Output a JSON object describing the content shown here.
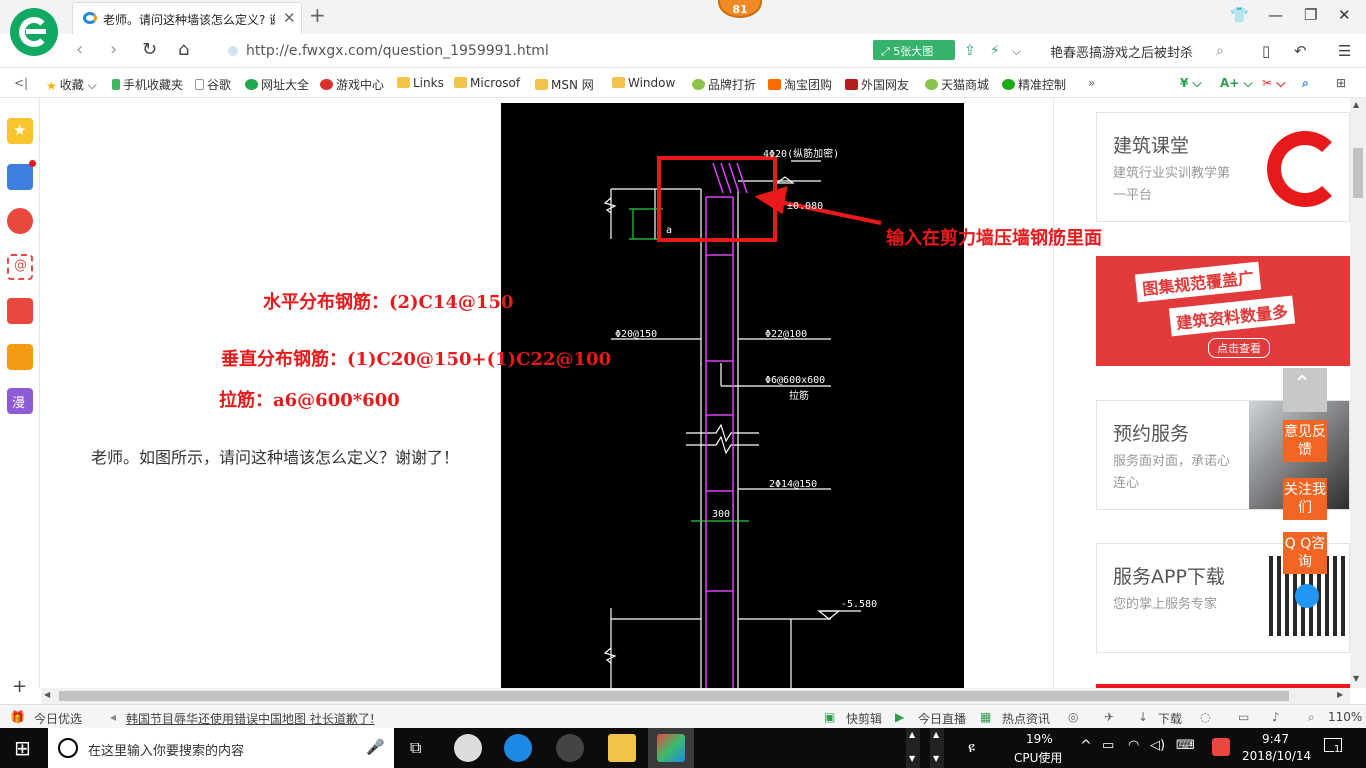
{
  "browser": {
    "tab_title": "老师。请问这种墙该怎么定义? 谢谢了!",
    "notification_count": "81",
    "url": "http://e.fwxgx.com/question_1959991.html",
    "big_image_button": "5张大图",
    "news_ticker": "艳春恶搞游戏之后被封杀",
    "bookmarks": [
      "收藏",
      "手机收藏夹",
      "谷歌",
      "网址大全",
      "游戏中心",
      "Links",
      "Microsof",
      "MSN 网",
      "Window",
      "品牌打折",
      "淘宝团购",
      "外国网友",
      "天猫商城",
      "精准控制"
    ],
    "more_bookmarks": "»"
  },
  "page": {
    "annotations": {
      "horizontal": "水平分布钢筋：(2)C14@150",
      "vertical": "垂直分布钢筋：(1)C20@150+(1)C22@100",
      "tie": "拉筋：a6@600*600",
      "callout": "输入在剪力墙压墙钢筋里面"
    },
    "question": "老师。如图所示，请问这种墙该怎么定义？谢谢了！",
    "drawing_labels": {
      "top_note": "4Φ20(纵筋加密)",
      "level_top": "±0.080",
      "dim_a": "a",
      "left_rebar": "Φ20@150",
      "right_rebar": "Φ22@100",
      "ties": "Φ6@600x600",
      "ties_note": "拉筋",
      "horizontal": "2Φ14@150",
      "width": "300",
      "level_bottom": "-5.580"
    },
    "sidebar_cards": [
      {
        "title": "建筑课堂",
        "subtitle": "建筑行业实训教学第一平台"
      },
      {
        "title": "预约服务",
        "subtitle": "服务面对面，承诺心连心"
      },
      {
        "title": "服务APP下载",
        "subtitle": "您的掌上服务专家"
      }
    ],
    "banner": {
      "line1": "图集规范覆盖广",
      "line2": "建筑资料数量多",
      "cta": "点击查看"
    },
    "float_buttons": [
      "意见反馈",
      "关注我们",
      "Q Q咨询"
    ]
  },
  "statusbar": {
    "today_pick": "今日优选",
    "headline": "韩国节目辱华还使用错误中国地图 社长道歉了!",
    "kuaijianji": "快剪辑",
    "live": "今日直播",
    "hot": "热点资讯",
    "download": "下载",
    "zoom": "110%"
  },
  "taskbar": {
    "search_placeholder": "在这里输入你要搜索的内容",
    "cpu_percent": "19%",
    "cpu_label": "CPU使用",
    "time": "9:47",
    "date": "2018/10/14",
    "notifications": "1"
  }
}
